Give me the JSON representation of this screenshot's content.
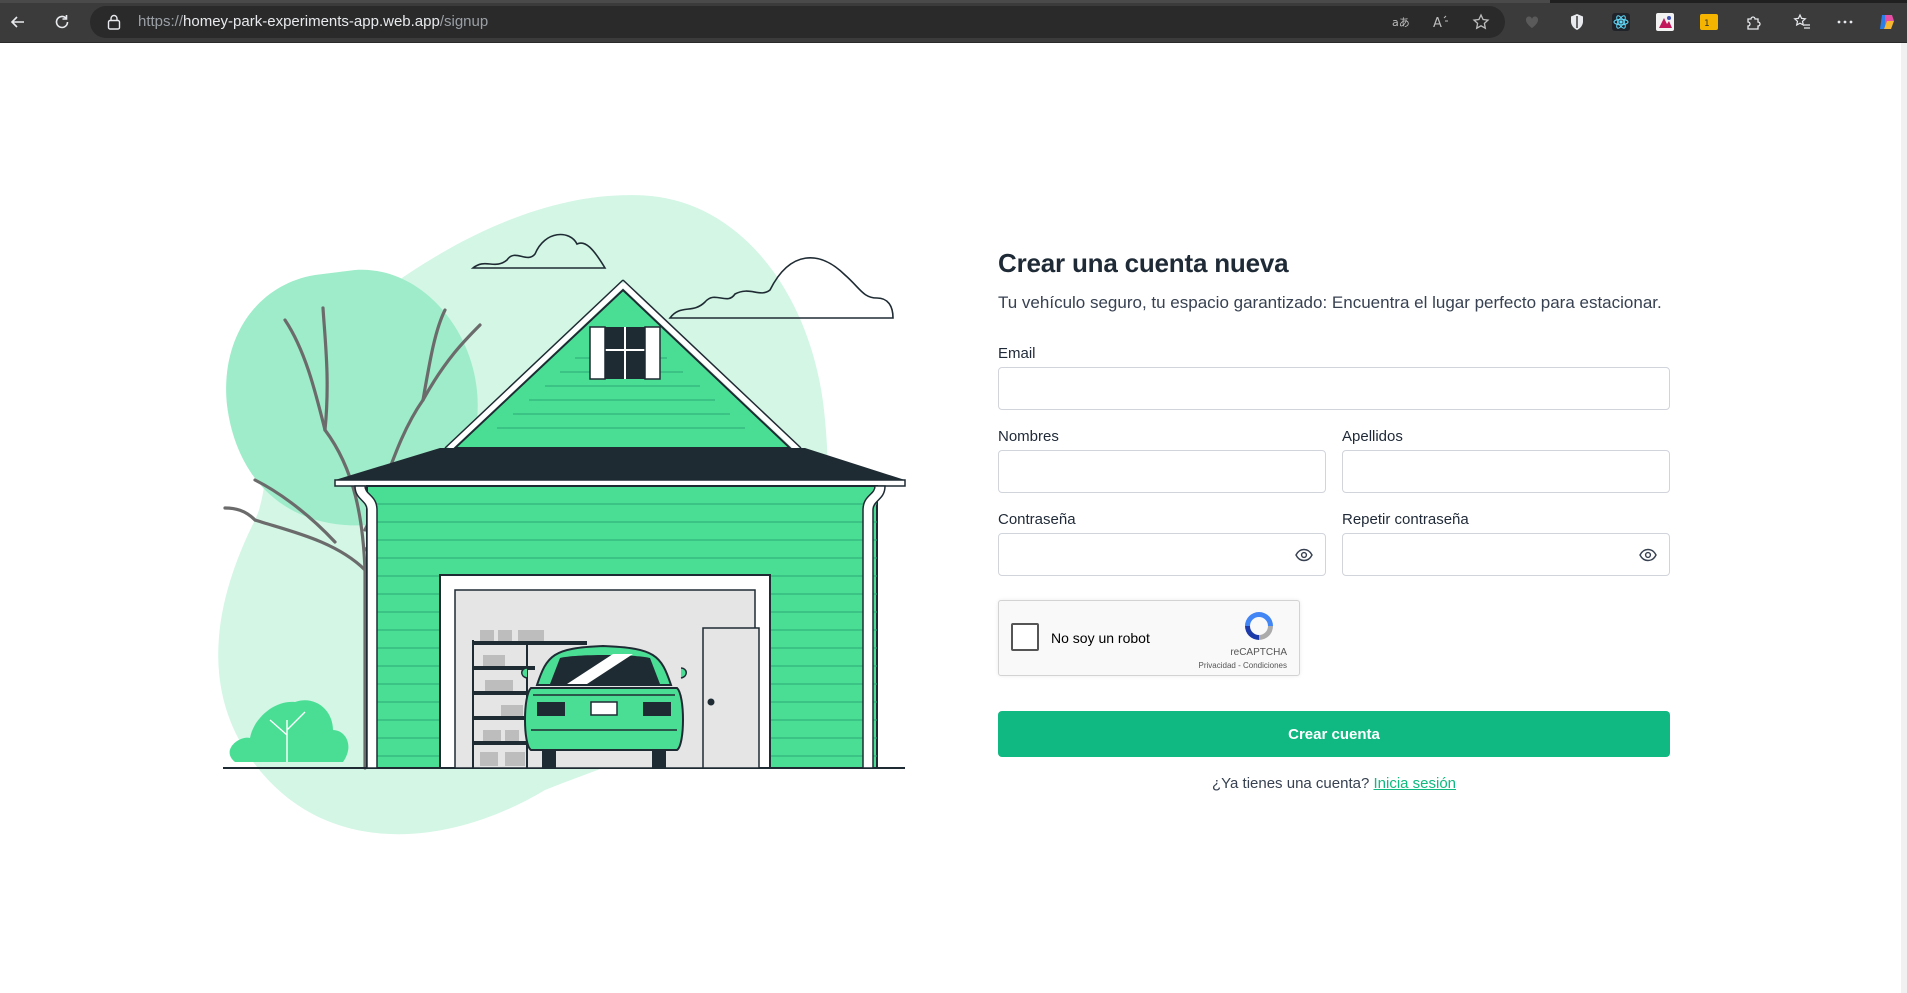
{
  "browser": {
    "url_prefix": "https://",
    "url_host": "homey-park-experiments-app.web.app",
    "url_path": "/signup"
  },
  "form": {
    "title": "Crear una cuenta nueva",
    "subtitle": "Tu vehículo seguro, tu espacio garantizado: Encuentra el lugar perfecto para estacionar.",
    "email_label": "Email",
    "email_value": "",
    "first_name_label": "Nombres",
    "first_name_value": "",
    "last_name_label": "Apellidos",
    "last_name_value": "",
    "password_label": "Contraseña",
    "password_value": "",
    "repeat_password_label": "Repetir contraseña",
    "repeat_password_value": "",
    "submit_label": "Crear cuenta",
    "login_prompt": "¿Ya tienes una cuenta?",
    "login_link": "Inicia sesión"
  },
  "captcha": {
    "label": "No soy un robot",
    "brand": "reCAPTCHA",
    "privacy": "Privacidad",
    "separator": " - ",
    "terms": "Condiciones"
  },
  "colors": {
    "accent": "#10b981",
    "house_green": "#4ade95",
    "blob_light": "#d3f6e5",
    "blob_mid": "#9eecc9",
    "roof_dark": "#1f2b33"
  }
}
